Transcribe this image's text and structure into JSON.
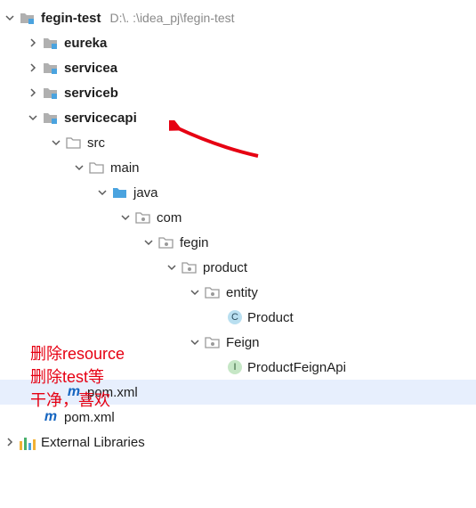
{
  "root": {
    "name": "fegin-test",
    "path": "D:\\. :\\idea_pj\\fegin-test"
  },
  "eureka": "eureka",
  "servicea": "servicea",
  "serviceb": "serviceb",
  "servicecapi": "servicecapi",
  "src": "src",
  "main": "main",
  "java": "java",
  "com": "com",
  "fegin": "fegin",
  "product": "product",
  "entity": "entity",
  "product_cls": "Product",
  "feign_pkg": "Feign",
  "feign_cls": "ProductFeignApi",
  "pom_inner": "pom.xml",
  "pom_outer": "pom.xml",
  "ext_libs": "External Libraries",
  "note_l1": "删除resource",
  "note_l2": "删除test等",
  "note_l3": "干净，喜欢"
}
